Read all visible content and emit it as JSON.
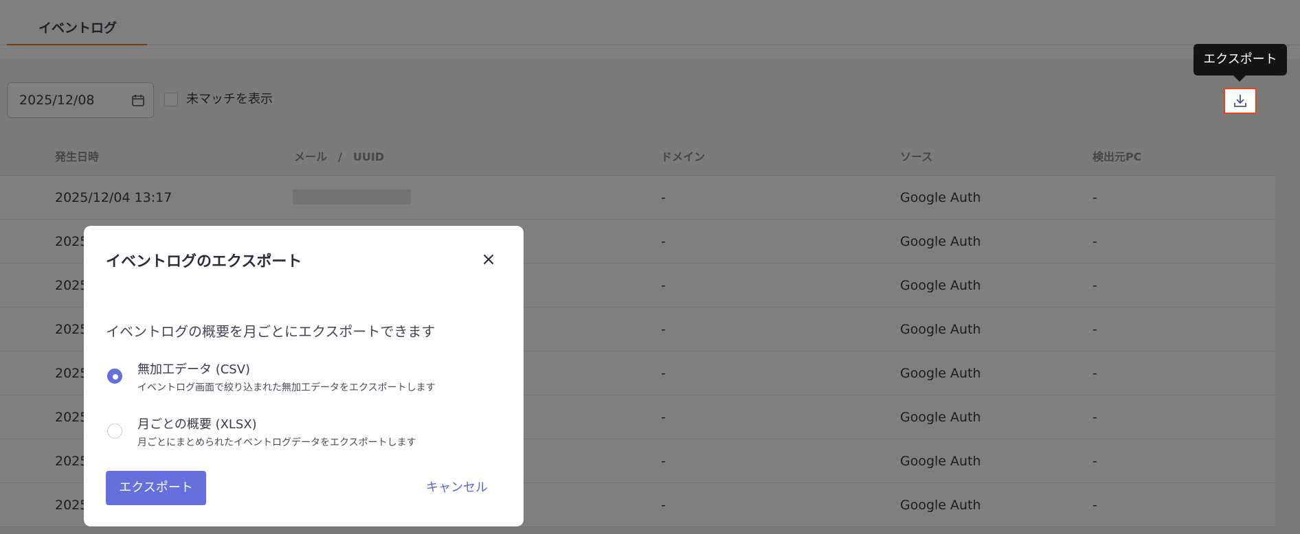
{
  "tabs": [
    {
      "label": "イベントログ",
      "active": true
    }
  ],
  "toolbar": {
    "date_value": "2025/12/08",
    "unmatched_label": "未マッチを表示",
    "unmatched_checked": false,
    "export_tooltip": "エクスポート"
  },
  "table": {
    "columns": [
      "発生日時",
      "メール　/　UUID",
      "ドメイン",
      "ソース",
      "検出元PC"
    ],
    "rows": [
      {
        "time": "2025/12/04 13:17",
        "email": "",
        "domain": "-",
        "source": "Google Auth",
        "pc": "-"
      },
      {
        "time": "2025",
        "email": "",
        "domain": "-",
        "source": "Google Auth",
        "pc": "-"
      },
      {
        "time": "2025",
        "email": "",
        "domain": "-",
        "source": "Google Auth",
        "pc": "-"
      },
      {
        "time": "2025",
        "email": "",
        "domain": "-",
        "source": "Google Auth",
        "pc": "-"
      },
      {
        "time": "2025",
        "email": "",
        "domain": "-",
        "source": "Google Auth",
        "pc": "-"
      },
      {
        "time": "2025",
        "email": "",
        "domain": "-",
        "source": "Google Auth",
        "pc": "-"
      },
      {
        "time": "2025",
        "email": "",
        "domain": "-",
        "source": "Google Auth",
        "pc": "-"
      },
      {
        "time": "2025",
        "email": "",
        "domain": "-",
        "source": "Google Auth",
        "pc": "-"
      }
    ]
  },
  "modal": {
    "title": "イベントログのエクスポート",
    "close_icon": "×",
    "description": "イベントログの概要を月ごとにエクスポートできます",
    "options": [
      {
        "label": "無加工データ (CSV)",
        "sub": "イベントログ画面で絞り込まれた無加工データをエクスポートします",
        "selected": true
      },
      {
        "label": "月ごとの概要 (XLSX)",
        "sub": "月ごとにまとめられたイベントログデータをエクスポートします",
        "selected": false
      }
    ],
    "export_label": "エクスポート",
    "cancel_label": "キャンセル"
  },
  "colors": {
    "accent": "#6570dd",
    "tab_underline": "#e07a1e",
    "highlight_border": "#e8431a",
    "tooltip_bg": "#141414"
  }
}
